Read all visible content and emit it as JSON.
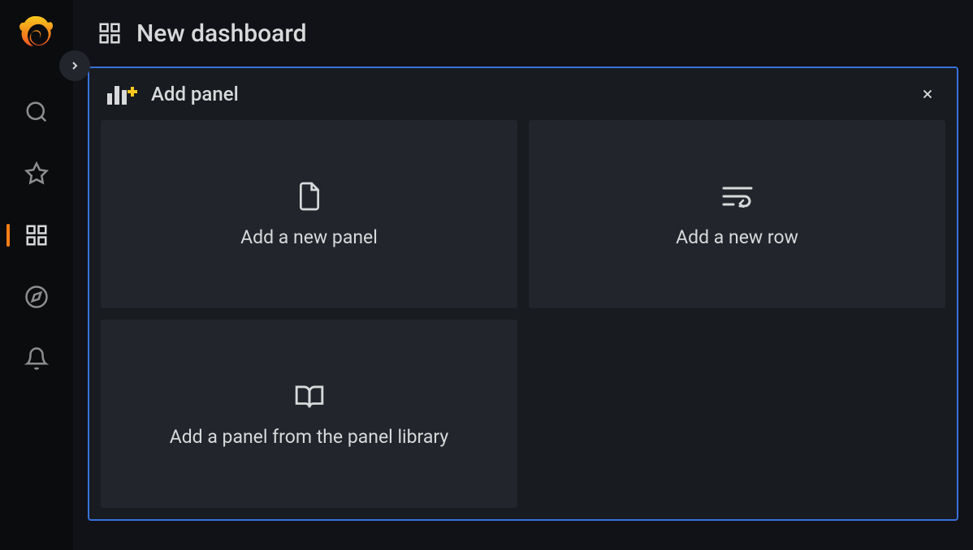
{
  "header": {
    "title": "New dashboard"
  },
  "panel": {
    "title": "Add panel",
    "options": [
      {
        "label": "Add a new panel"
      },
      {
        "label": "Add a new row"
      },
      {
        "label": "Add a panel from the panel library"
      }
    ]
  }
}
